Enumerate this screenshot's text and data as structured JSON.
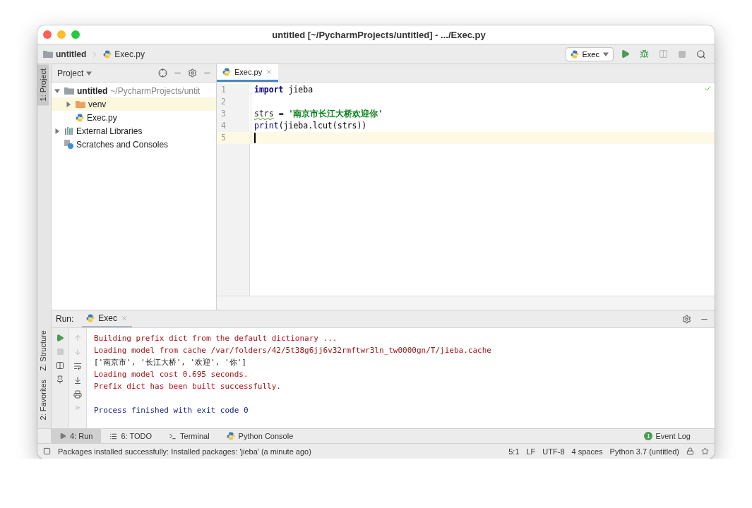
{
  "window": {
    "title": "untitled [~/PycharmProjects/untitled] - .../Exec.py"
  },
  "breadcrumbs": [
    {
      "label": "untitled",
      "kind": "folder"
    },
    {
      "label": "Exec.py",
      "kind": "python"
    }
  ],
  "run_config": {
    "label": "Exec"
  },
  "left_stripe": {
    "top": [
      {
        "label": "1: Project",
        "selected": true
      }
    ],
    "bottom": [
      {
        "label": "Z: Structure",
        "selected": false
      },
      {
        "label": "2: Favorites",
        "selected": false
      }
    ]
  },
  "project_panel": {
    "title": "Project",
    "tree": [
      {
        "label": "untitled",
        "path": "~/PycharmProjects/untit",
        "kind": "folder",
        "expanded": true,
        "selected": false,
        "children": [
          {
            "label": "venv",
            "kind": "excluded",
            "expanded": false,
            "selected": true
          },
          {
            "label": "Exec.py",
            "kind": "python",
            "selected": false
          }
        ]
      },
      {
        "label": "External Libraries",
        "kind": "library",
        "expanded": false,
        "selected": false
      },
      {
        "label": "Scratches and Consoles",
        "kind": "scratches",
        "selected": false
      }
    ]
  },
  "editor": {
    "tabs": [
      {
        "label": "Exec.py",
        "selected": true
      }
    ],
    "lines": [
      {
        "number": "1",
        "current": false,
        "tokens": [
          {
            "text": "import",
            "kind": "keyword"
          },
          {
            "text": " jieba",
            "kind": "plain"
          }
        ]
      },
      {
        "number": "2",
        "current": false
      },
      {
        "number": "3",
        "current": false,
        "tokens": [
          {
            "text": "strs",
            "kind": "typo"
          },
          {
            "text": " = ",
            "kind": "plain"
          },
          {
            "text": "'南京市长江大桥欢迎你'",
            "kind": "string"
          }
        ]
      },
      {
        "number": "4",
        "current": false,
        "tokens": [
          {
            "text": "print",
            "kind": "builtin"
          },
          {
            "text": "(jieba.lcut(strs))",
            "kind": "plain"
          }
        ]
      },
      {
        "number": "5",
        "current": true
      }
    ]
  },
  "run_panel": {
    "title": "Run:",
    "tabs": [
      {
        "label": "Exec",
        "selected": true
      }
    ],
    "output": [
      {
        "text": "Building prefix dict from the default dictionary ...",
        "kind": "stderr"
      },
      {
        "text": "Loading model from cache /var/folders/42/5t38g6jj6v32rmftwr3ln_tw0000gn/T/jieba.cache",
        "kind": "stderr"
      },
      {
        "text": "['南京市', '长江大桥', '欢迎', '你']",
        "kind": "stdout"
      },
      {
        "text": "Loading model cost 0.695 seconds.",
        "kind": "stderr"
      },
      {
        "text": "Prefix dict has been built successfully.",
        "kind": "stderr"
      },
      {
        "kind": "blank"
      },
      {
        "text": "Process finished with exit code 0",
        "kind": "system"
      }
    ]
  },
  "tool_tabs": [
    {
      "label": "4: Run",
      "kind": "run",
      "selected": true
    },
    {
      "label": "6: TODO",
      "kind": "todo",
      "selected": false
    },
    {
      "label": "Terminal",
      "kind": "terminal",
      "selected": false
    },
    {
      "label": "Python Console",
      "kind": "python",
      "selected": false
    }
  ],
  "event_log": {
    "label": "Event Log",
    "count": "1"
  },
  "status_bar": {
    "message": "Packages installed successfully: Installed packages: 'jieba' (a minute ago)",
    "items": [
      "5:1",
      "LF",
      "UTF-8",
      "4 spaces",
      "Python 3.7 (untitled)"
    ]
  }
}
